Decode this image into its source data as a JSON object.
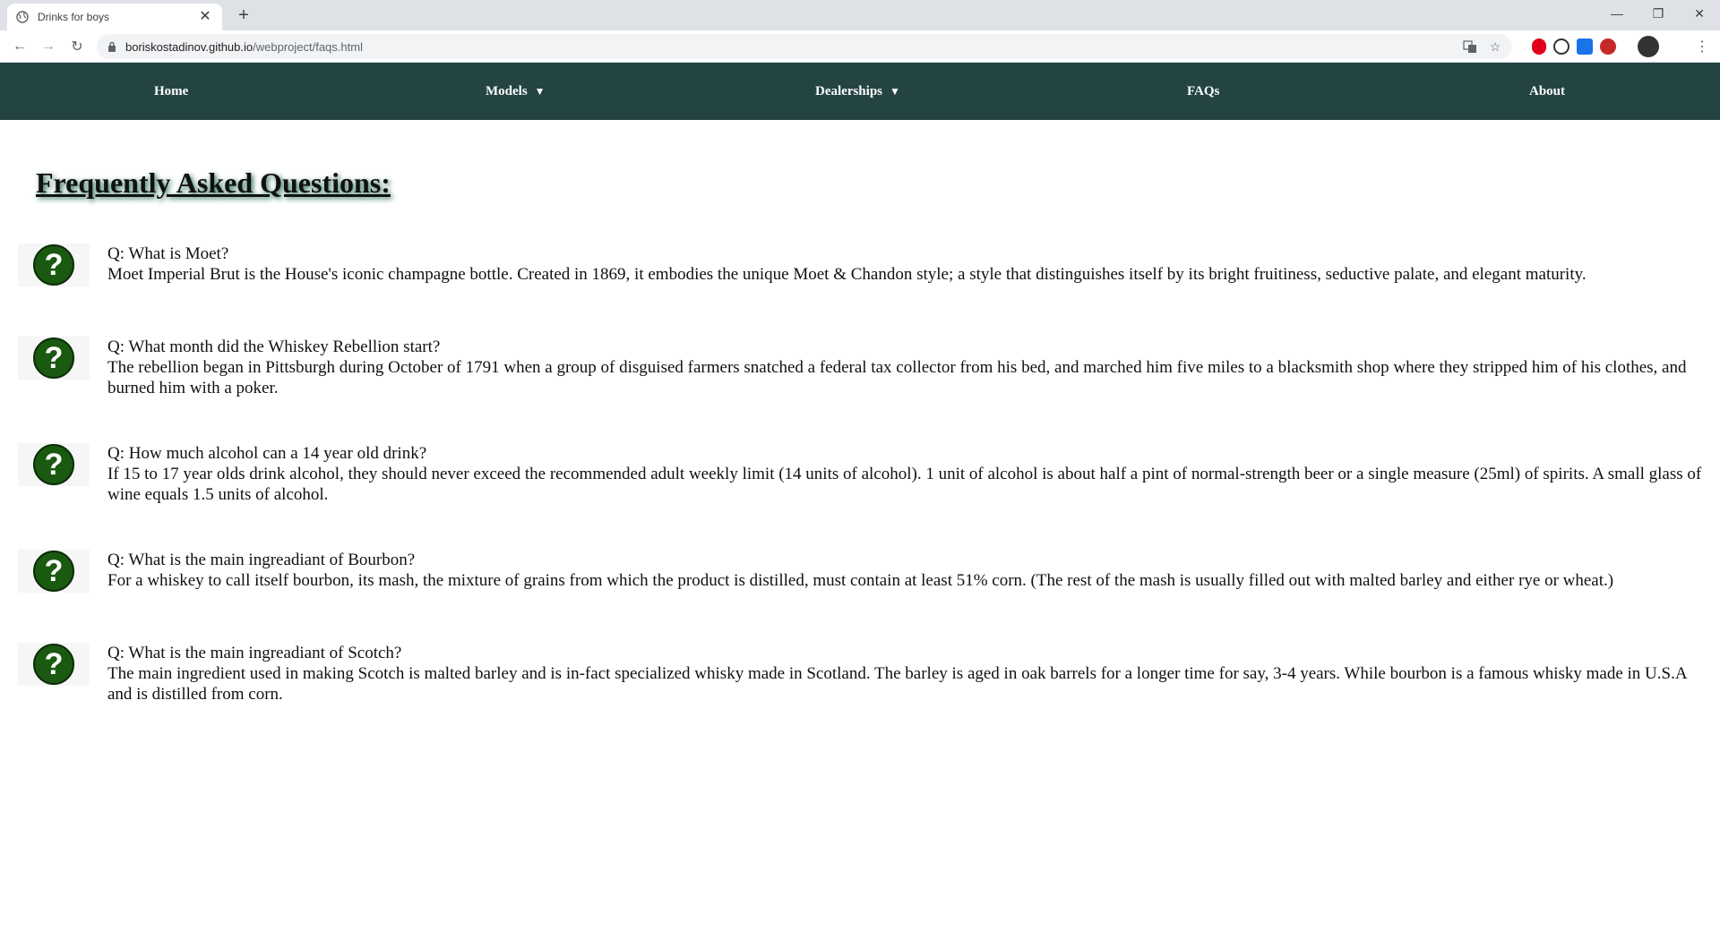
{
  "browser": {
    "tab_title": "Drinks for boys",
    "new_tab": "+",
    "url_host": "boriskostadinov.github.io",
    "url_path": "/webproject/faqs.html"
  },
  "nav": {
    "home": "Home",
    "models": "Models",
    "dealerships": "Dealerships",
    "faqs": "FAQs",
    "about": "About",
    "caret": "▼"
  },
  "page": {
    "title": "Frequently Asked Questions:"
  },
  "faqs": [
    {
      "question": "Q: What is Moet?",
      "answer": "Moet Imperial Brut is the House's iconic champagne bottle. Created in 1869, it embodies the unique Moet & Chandon style; a style that distinguishes itself by its bright fruitiness, seductive palate, and elegant maturity."
    },
    {
      "question": "Q: What month did the Whiskey Rebellion start?",
      "answer": "The rebellion began in Pittsburgh during October of 1791 when a group of disguised farmers snatched a federal tax collector from his bed, and marched him five miles to a blacksmith shop where they stripped him of his clothes, and burned him with a poker."
    },
    {
      "question": "Q: How much alcohol can a 14 year old drink?",
      "answer": "If 15 to 17 year olds drink alcohol, they should never exceed the recommended adult weekly limit (14 units of alcohol). 1 unit of alcohol is about half a pint of normal-strength beer or a single measure (25ml) of spirits. A small glass of wine equals 1.5 units of alcohol."
    },
    {
      "question": "Q: What is the main ingreadiant of Bourbon?",
      "answer": "For a whiskey to call itself bourbon, its mash, the mixture of grains from which the product is distilled, must contain at least 51% corn. (The rest of the mash is usually filled out with malted barley and either rye or wheat.)"
    },
    {
      "question": "Q: What is the main ingreadiant of Scotch?",
      "answer": "The main ingredient used in making Scotch is malted barley and is in-fact specialized whisky made in Scotland. The barley is aged in oak barrels for a longer time for say, 3-4 years. While bourbon is a famous whisky made in U.S.A and is distilled from corn."
    }
  ],
  "icons": {
    "question_mark": "?"
  }
}
